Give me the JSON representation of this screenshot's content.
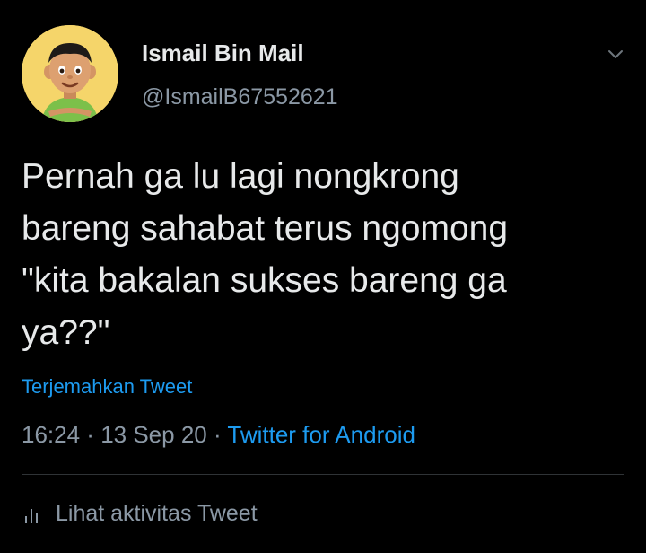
{
  "user": {
    "display_name": "Ismail Bin Mail",
    "handle": "@IsmailB67552621",
    "avatar_icon": "cartoon-boy-avatar"
  },
  "tweet": {
    "text": "Pernah ga lu lagi nongkrong\nbareng sahabat terus ngomong\n\"kita bakalan sukses bareng ga\nya??\"",
    "translate_label": "Terjemahkan Tweet",
    "time": "16:24",
    "separator1": " · ",
    "date": "13 Sep 20",
    "separator2": " · ",
    "source": "Twitter for Android"
  },
  "activity": {
    "label": "Lihat aktivitas Tweet",
    "icon": "bar-chart-icon"
  },
  "colors": {
    "background": "#000000",
    "primary_text": "#e7e9ea",
    "secondary_text": "#8b98a5",
    "link": "#1d9bf0",
    "divider": "#2f3336"
  }
}
